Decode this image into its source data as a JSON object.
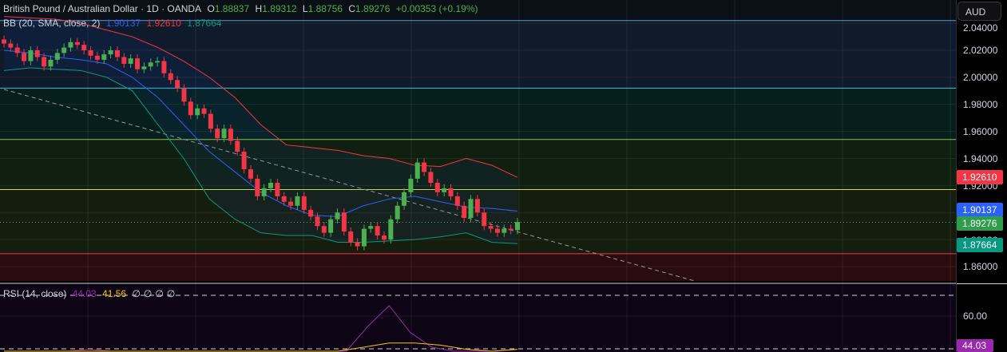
{
  "header": {
    "symbol": "British Pound / Australian Dollar · 1D · OANDA",
    "o_label": "O",
    "o": "1.88837",
    "h_label": "H",
    "h": "1.89312",
    "l_label": "L",
    "l": "1.88756",
    "c_label": "C",
    "c": "1.89276",
    "change": "+0.00353 (+0.19%)"
  },
  "bb": {
    "label": "BB (20, SMA, close, 2)",
    "basis": "1.90137",
    "upper": "1.92610",
    "lower": "1.87664"
  },
  "rsi": {
    "label": "RSI (14, close)",
    "value": "44.03",
    "ma": "41.56",
    "extra": [
      "∅",
      "∅",
      "∅",
      "∅"
    ]
  },
  "axis": {
    "currency": "AUD",
    "ticks": [
      "2.04000",
      "2.02000",
      "2.00000",
      "1.98000",
      "1.96000",
      "1.94000",
      "1.92000",
      "1.90000",
      "1.88000",
      "1.86000"
    ],
    "rsi_ticks": [
      "60.00"
    ],
    "badges": [
      {
        "value": "1.92610",
        "color": "#f23645"
      },
      {
        "value": "1.90137",
        "color": "#2962ff"
      },
      {
        "value": "1.89276",
        "color": "#22ab94"
      },
      {
        "value": "1.87664",
        "color": "#089981"
      },
      {
        "value": "44.03",
        "color": "#9c27b0"
      }
    ]
  },
  "colors": {
    "up": "#26a69a",
    "up_fill": "#4caf50",
    "down": "#f23645",
    "basis": "#2962ff",
    "upper": "#f23645",
    "lower": "#089981",
    "rsi": "#9c27b0",
    "rsi_ma": "#f7c600"
  },
  "chart_data": {
    "type": "candlestick",
    "ylim": [
      1.845,
      2.048
    ],
    "closes": [
      2.025,
      2.022,
      2.018,
      2.012,
      2.02,
      2.015,
      2.008,
      2.013,
      2.018,
      2.022,
      2.026,
      2.024,
      2.02,
      2.016,
      2.013,
      2.017,
      2.02,
      2.015,
      2.01,
      2.014,
      2.006,
      2.008,
      2.011,
      2.012,
      2.003,
      1.998,
      1.992,
      1.982,
      1.972,
      1.977,
      1.973,
      1.962,
      1.955,
      1.962,
      1.953,
      1.945,
      1.932,
      1.925,
      1.912,
      1.918,
      1.922,
      1.912,
      1.908,
      1.905,
      1.912,
      1.902,
      1.897,
      1.89,
      1.885,
      1.895,
      1.9,
      1.886,
      1.878,
      1.875,
      1.888,
      1.89,
      1.883,
      1.88,
      1.895,
      1.905,
      1.915,
      1.925,
      1.937,
      1.93,
      1.922,
      1.915,
      1.918,
      1.912,
      1.905,
      1.896,
      1.91,
      1.9,
      1.89,
      1.888,
      1.885,
      1.888,
      1.887,
      1.893
    ],
    "bb_upper": [
      2.045,
      2.044,
      2.043,
      2.04,
      2.035,
      2.03,
      2.022,
      2.012,
      2.0,
      1.985,
      1.965,
      1.95,
      1.948,
      1.946,
      1.942,
      1.94,
      1.935,
      1.934,
      1.94,
      1.935,
      1.926
    ],
    "bb_basis": [
      2.02,
      2.018,
      2.015,
      2.013,
      2.01,
      2.0,
      1.985,
      1.965,
      1.945,
      1.93,
      1.915,
      1.905,
      1.898,
      1.897,
      1.905,
      1.91,
      1.912,
      1.908,
      1.904,
      1.903,
      1.901
    ],
    "bb_lower": [
      2.005,
      2.007,
      2.006,
      2.005,
      2.0,
      1.99,
      1.965,
      1.94,
      1.91,
      1.895,
      1.885,
      1.883,
      1.883,
      1.878,
      1.878,
      1.879,
      1.88,
      1.882,
      1.885,
      1.878,
      1.877
    ],
    "levels": [
      2.042,
      1.992,
      1.954,
      1.917,
      1.8695
    ],
    "rsi": [
      38,
      42,
      40,
      36,
      44,
      39,
      41,
      35,
      38,
      36,
      40,
      37,
      42,
      34,
      37,
      30,
      31,
      55,
      65,
      52,
      45,
      40,
      36,
      34,
      44
    ],
    "rsi_ma": [
      40,
      40,
      40,
      40,
      40,
      40,
      39,
      39,
      38,
      37,
      36,
      36,
      37,
      40,
      45,
      47,
      47,
      46,
      44,
      42,
      44
    ]
  }
}
